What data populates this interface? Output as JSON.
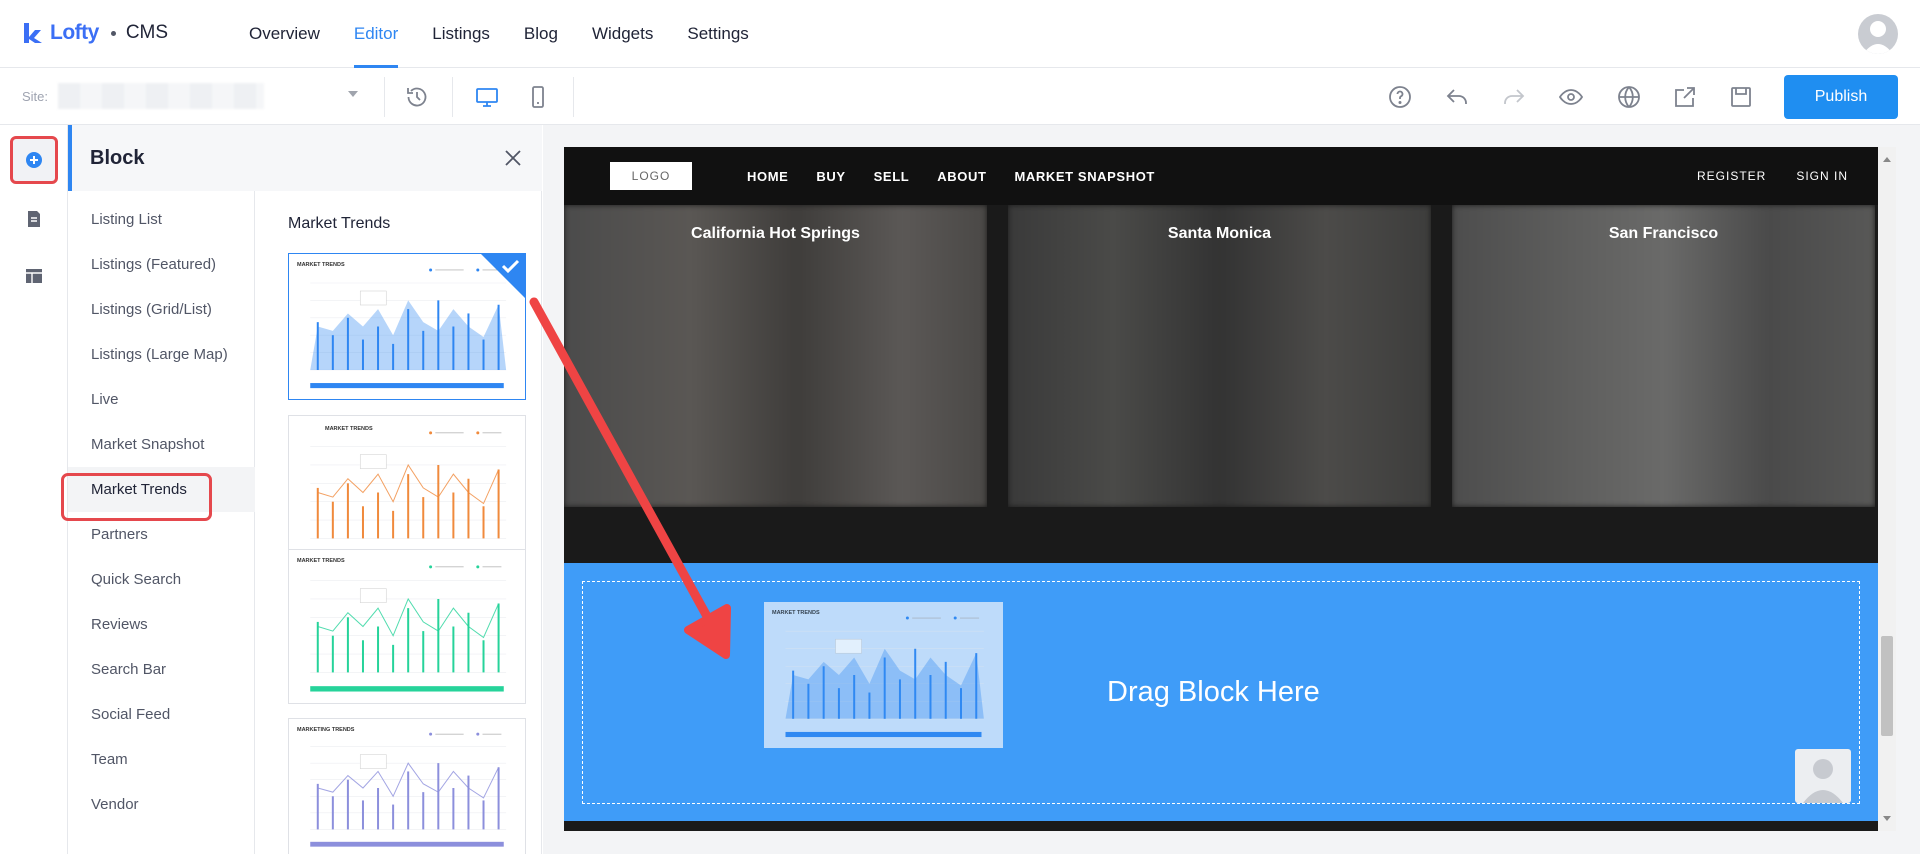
{
  "app": {
    "brand": "Lofty",
    "product": "CMS",
    "brand_color": "#3b6ff5",
    "accent_color": "#2e86f2",
    "highlight_color": "#e5484d"
  },
  "top_nav": {
    "items": [
      {
        "label": "Overview",
        "active": false
      },
      {
        "label": "Editor",
        "active": true
      },
      {
        "label": "Listings",
        "active": false
      },
      {
        "label": "Blog",
        "active": false
      },
      {
        "label": "Widgets",
        "active": false
      },
      {
        "label": "Settings",
        "active": false
      }
    ]
  },
  "toolbar": {
    "site_label": "Site:",
    "icons": [
      "history-icon",
      "desktop-icon",
      "mobile-icon",
      "help-icon",
      "undo-icon",
      "redo-icon",
      "preview-icon",
      "globe-icon",
      "share-icon",
      "save-icon"
    ],
    "publish_label": "Publish"
  },
  "rail": {
    "icons": [
      "add-block-icon",
      "pages-icon",
      "layout-icon"
    ]
  },
  "block_panel": {
    "title": "Block",
    "categories": [
      {
        "label": "Listing List"
      },
      {
        "label": "Listings (Featured)"
      },
      {
        "label": "Listings (Grid/List)"
      },
      {
        "label": "Listings (Large Map)"
      },
      {
        "label": "Live"
      },
      {
        "label": "Market Snapshot"
      },
      {
        "label": "Market Trends",
        "active": true
      },
      {
        "label": "Partners"
      },
      {
        "label": "Quick Search"
      },
      {
        "label": "Reviews"
      },
      {
        "label": "Search Bar"
      },
      {
        "label": "Social Feed"
      },
      {
        "label": "Team"
      },
      {
        "label": "Vendor"
      }
    ],
    "preview_heading": "Market Trends",
    "thumbnails": [
      {
        "title": "MARKET TRENDS",
        "theme": "#2e86f2",
        "selected": true
      },
      {
        "title": "MARKET TRENDS",
        "theme": "#f08a3c",
        "selected": false
      },
      {
        "title": "MARKET TRENDS",
        "theme": "#26d39a",
        "selected": false
      },
      {
        "title": "MARKETING TRENDS",
        "theme": "#8c8fdc",
        "selected": false
      }
    ]
  },
  "website": {
    "logo": "LOGO",
    "menu": [
      "HOME",
      "BUY",
      "SELL",
      "ABOUT",
      "MARKET SNAPSHOT"
    ],
    "auth": [
      "REGISTER",
      "SIGN IN"
    ],
    "cities": [
      "California Hot Springs",
      "Santa Monica",
      "San Francisco"
    ],
    "drop_text": "Drag Block Here",
    "drop_color": "#3f9cf8"
  }
}
